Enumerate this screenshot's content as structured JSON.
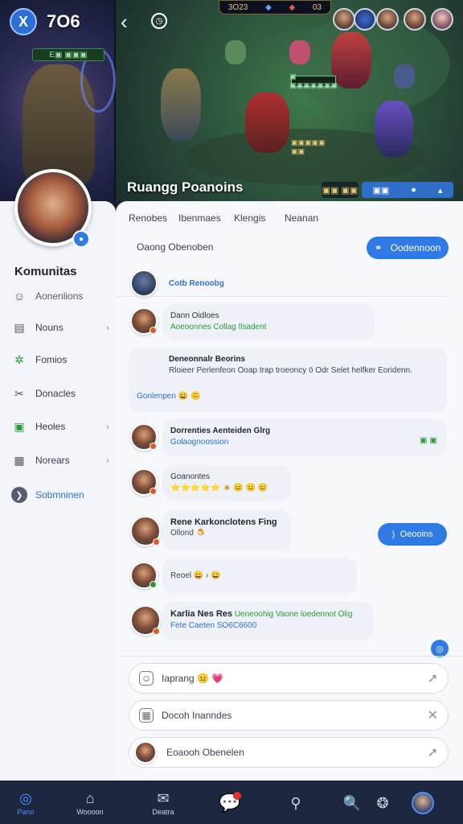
{
  "hud": {
    "level": "7O6",
    "mode_glyph": "X",
    "level_bar_text": "E▣ ▣▣▣",
    "top_score_left": "3O23",
    "top_score_right": "03",
    "timer_glyph": "◷",
    "back_glyph": "‹",
    "mini_status": "▣ ▣▣▣▣▣▣▣",
    "mini_status2": "▣▣▣▣▣ ▣▣",
    "bottom_left": "▣▣ ▣▣",
    "live_left": "▣▣",
    "live_right": "▣"
  },
  "stream": {
    "title": "Ruangg Poanoins"
  },
  "sidebar": {
    "title": "Komunitas",
    "items": [
      {
        "label": "Aonenlions",
        "icon": "☺"
      },
      {
        "label": "Nouns",
        "icon": "▤"
      },
      {
        "label": "Fomios",
        "icon": "✲"
      },
      {
        "label": "Donacles",
        "icon": "✂"
      },
      {
        "label": "Heoles",
        "icon": "▣"
      },
      {
        "label": "Norears",
        "icon": "▦"
      },
      {
        "label": "Sobmninen",
        "icon": "❯"
      }
    ]
  },
  "tabs": [
    "Renobes",
    "Ibenmaes",
    "Klengis",
    "Neanan"
  ],
  "filter": {
    "label": "Oaong Obenoben",
    "button_label": "Oodennoon",
    "button_icon": "⚭"
  },
  "messages": [
    {
      "name": "Cotb Renoobg"
    },
    {
      "name": "Dann Oidloes",
      "text": "Aoeoonnes Collag Ilsadent"
    },
    {
      "name": "Deneonnalr Beorins",
      "text": "Rloieer Perlenfeon Ooap trap troeoncy ö Odr Selet helfker Eoridenn.",
      "extra": "Gonlenpen 😀 🙃"
    },
    {
      "name": "Dorrenties Aenteiden Glrg",
      "text": "Golaognoossion",
      "badge": "▣ ▣"
    },
    {
      "name": "Goanontes",
      "text": "⭐⭐⭐⭐⭐ ☻ 😐 😐 😐"
    },
    {
      "name": "Rene Karkonclotens Fing",
      "text": "Ollond 🍮"
    },
    {
      "name": "",
      "text": "Reoel 😀 › 😀"
    },
    {
      "name": "Karlia Nes Res",
      "text": "Ueneoohig Vaone loedennot Olig",
      "extra": "Fete Caeten SO6C6600"
    }
  ],
  "reply_button": {
    "label": "Oeooins",
    "icon": "⟩"
  },
  "scroll_badge": "◎",
  "composers": [
    {
      "label": "Iaprang 😐 💗",
      "icon": "☺",
      "send": "➚"
    },
    {
      "label": "Docoh Inanndes",
      "icon": "▦",
      "send": "✕"
    },
    {
      "label": "Eoaooh Obenelen",
      "icon": "",
      "send": "➚"
    }
  ],
  "bottom_nav": [
    {
      "label": "Pano",
      "icon": "◎"
    },
    {
      "label": "Woooon",
      "icon": "⌂"
    },
    {
      "label": "Deatra",
      "icon": "✉"
    },
    {
      "label": "",
      "icon": "💬"
    },
    {
      "label": "",
      "icon": "⚲"
    },
    {
      "label": "",
      "icon": "🔍"
    },
    {
      "label": "",
      "icon": "❂"
    },
    {
      "label": "",
      "icon": ""
    }
  ],
  "colors": {
    "accent": "#2f7ae5",
    "nav_bg": "#1e2740",
    "panel_bg": "#f7f8fc"
  }
}
